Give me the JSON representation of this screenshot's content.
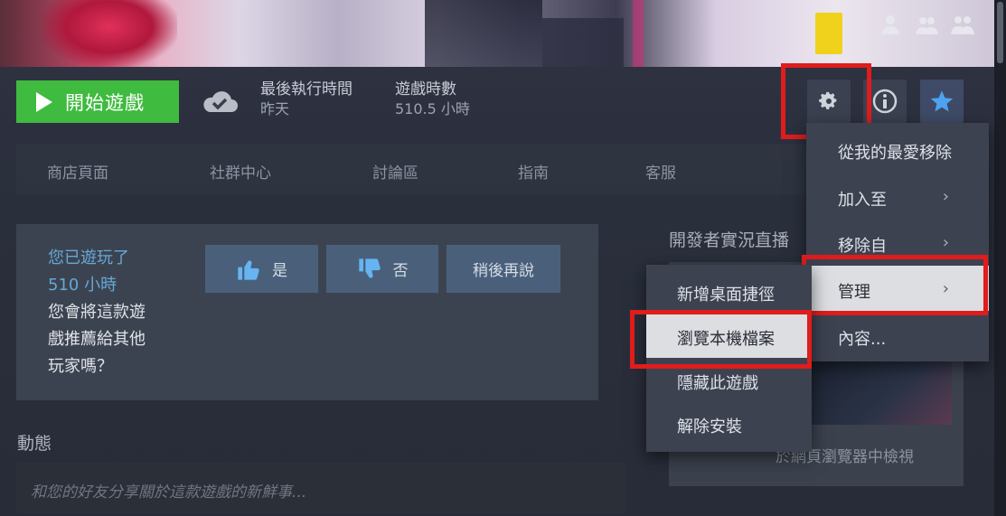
{
  "header": {
    "play_label": "開始遊戲",
    "last_run_label": "最後執行時間",
    "last_run_value": "昨天",
    "playtime_label": "遊戲時數",
    "playtime_value": "510.5 小時"
  },
  "nav": {
    "items": [
      "商店頁面",
      "社群中心",
      "討論區",
      "指南",
      "客服"
    ]
  },
  "recommend": {
    "played_line1": "您已遊玩了",
    "played_line2": "510 小時",
    "question_line1": "您會將這款遊",
    "question_line2": "戲推薦給其他",
    "question_line3": "玩家嗎？",
    "yes_label": "是",
    "no_label": "否",
    "later_label": "稍後再說"
  },
  "activity": {
    "title": "動態",
    "placeholder": "和您的好友分享關於這款遊戲的新鮮事..."
  },
  "developer": {
    "title": "開發者實況直播",
    "link": "於網頁瀏覽器中檢視"
  },
  "context_menu": {
    "items": [
      {
        "label": "從我的最愛移除",
        "submenu": false
      },
      {
        "label": "加入至",
        "submenu": true
      },
      {
        "label": "移除自",
        "submenu": true
      },
      {
        "label": "管理",
        "submenu": true,
        "highlighted": true
      },
      {
        "label": "內容...",
        "submenu": false
      }
    ]
  },
  "manage_submenu": {
    "items": [
      {
        "label": "新增桌面捷徑"
      },
      {
        "label": "瀏覽本機檔案",
        "highlighted": true
      },
      {
        "label": "隱藏此遊戲"
      },
      {
        "label": "解除安裝"
      }
    ]
  },
  "colors": {
    "play_green": "#3fbb3f",
    "highlight_red": "#e01c1c",
    "accent_blue": "#66a8d6"
  },
  "icons": [
    "play-icon",
    "cloud-check-icon",
    "gear-icon",
    "info-icon",
    "star-icon",
    "thumbs-up-icon",
    "thumbs-down-icon",
    "friends-icon",
    "chevron-right-icon"
  ]
}
